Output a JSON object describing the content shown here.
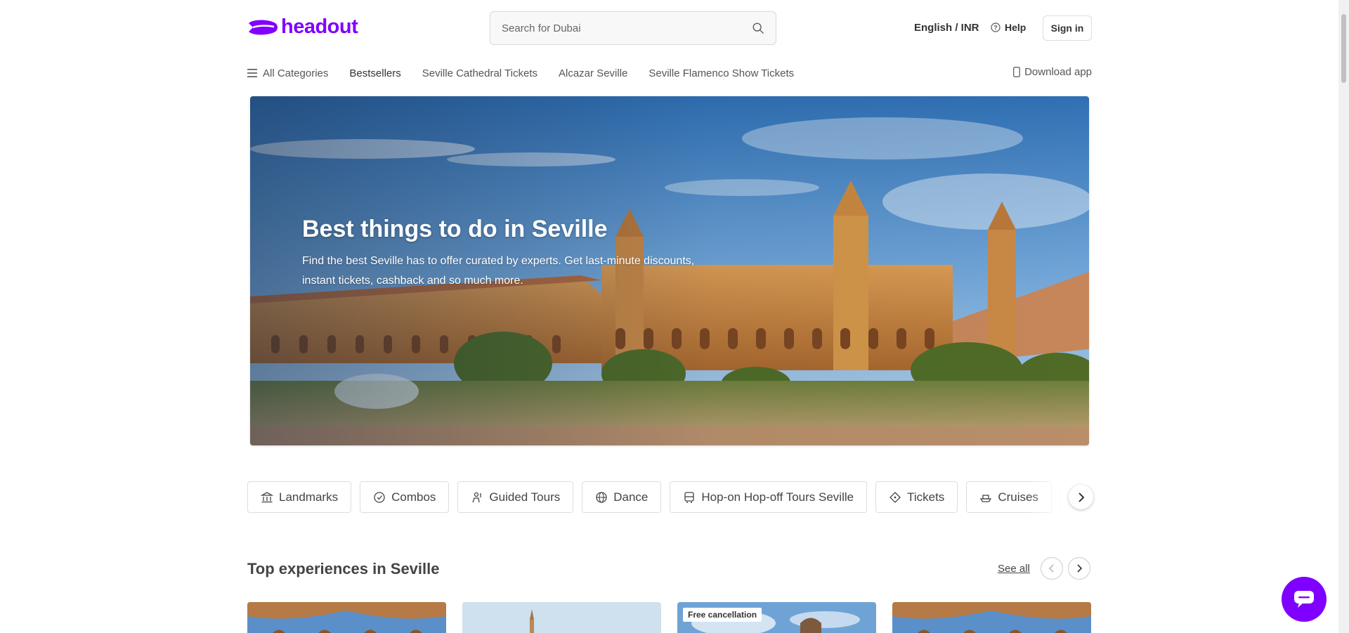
{
  "header": {
    "logo_text": "headout",
    "search_placeholder": "Search for Dubai",
    "language_currency": "English / INR",
    "help_label": "Help",
    "signin_label": "Sign in"
  },
  "nav": {
    "all_categories": "All Categories",
    "items": [
      "Bestsellers",
      "Seville Cathedral Tickets",
      "Alcazar Seville",
      "Seville Flamenco Show Tickets"
    ],
    "download_app": "Download app"
  },
  "hero": {
    "title": "Best things to do in Seville",
    "subtitle_line1": "Find the best Seville has to offer curated by experts. Get last-minute discounts,",
    "subtitle_line2": "instant tickets, cashback and so much more."
  },
  "categories": [
    {
      "label": "Landmarks",
      "icon": "landmark-icon"
    },
    {
      "label": "Combos",
      "icon": "combo-icon"
    },
    {
      "label": "Guided Tours",
      "icon": "guide-icon"
    },
    {
      "label": "Dance",
      "icon": "globe-icon"
    },
    {
      "label": "Hop-on Hop-off Tours Seville",
      "icon": "bus-icon"
    },
    {
      "label": "Tickets",
      "icon": "ticket-icon"
    },
    {
      "label": "Cruises",
      "icon": "boat-icon"
    },
    {
      "label": "",
      "icon": "more-icon"
    }
  ],
  "top_experiences": {
    "title": "Top experiences in Seville",
    "see_all": "See all",
    "cards": [
      {
        "badge": ""
      },
      {
        "badge": ""
      },
      {
        "badge": "Free cancellation"
      },
      {
        "badge": ""
      }
    ]
  },
  "colors": {
    "brand": "#8000ff",
    "text": "#444444",
    "border": "#dddddd"
  }
}
